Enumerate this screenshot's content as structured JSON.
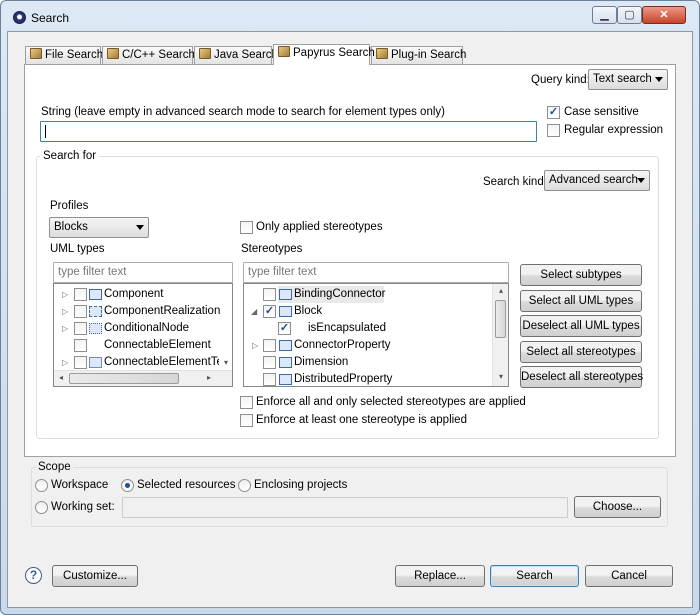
{
  "window": {
    "title": "Search",
    "min_icon": "minimize-icon",
    "max_icon": "maximize-icon",
    "close_icon": "close-icon"
  },
  "tabs": [
    {
      "label": "File Search",
      "icon": "file-search-icon"
    },
    {
      "label": "C/C++ Search",
      "icon": "c-search-icon"
    },
    {
      "label": "Java Search",
      "icon": "java-search-icon"
    },
    {
      "label": "Papyrus Search",
      "icon": "papyrus-search-icon",
      "active": true
    },
    {
      "label": "Plug-in Search",
      "icon": "plugin-search-icon"
    }
  ],
  "query_kind": {
    "label": "Query kind:",
    "value": "Text search"
  },
  "string": {
    "label": "String (leave empty in advanced search mode to search for element types only)",
    "value": ""
  },
  "case_sensitive": {
    "label": "Case sensitive",
    "checked": true
  },
  "regular_expression": {
    "label": "Regular expression",
    "checked": false
  },
  "search_for": {
    "title": "Search for",
    "search_kind_label": "Search kind:",
    "search_kind_value": "Advanced search",
    "profiles_label": "Profiles",
    "profiles_value": "Blocks",
    "only_applied_label": "Only applied stereotypes",
    "uml_types_label": "UML types",
    "uml_filter_placeholder": "type filter text",
    "uml_items": [
      "Component",
      "ComponentRealization",
      "ConditionalNode",
      "ConnectableElement",
      "ConnectableElementTe"
    ],
    "stereotypes_label": "Stereotypes",
    "stereo_filter_placeholder": "type filter text",
    "stereo_items": [
      {
        "label": "BindingConnector",
        "checked": false
      },
      {
        "label": "Block",
        "checked": true
      },
      {
        "label": "isEncapsulated",
        "checked": true
      },
      {
        "label": "ConnectorProperty",
        "checked": false
      },
      {
        "label": "Dimension",
        "checked": false
      },
      {
        "label": "DistributedProperty",
        "checked": false
      }
    ],
    "buttons": [
      "Select subtypes",
      "Select all UML types",
      "Deselect all UML types",
      "Select all stereotypes",
      "Deselect all stereotypes"
    ],
    "enforce_all_label": "Enforce all and only selected stereotypes are applied",
    "enforce_one_label": "Enforce at least one stereotype is applied"
  },
  "scope": {
    "title": "Scope",
    "workspace": "Workspace",
    "selected_resources": "Selected resources",
    "enclosing_projects": "Enclosing projects",
    "working_set": "Working set:",
    "choose": "Choose..."
  },
  "footer": {
    "customize": "Customize...",
    "replace": "Replace...",
    "search": "Search",
    "cancel": "Cancel"
  }
}
